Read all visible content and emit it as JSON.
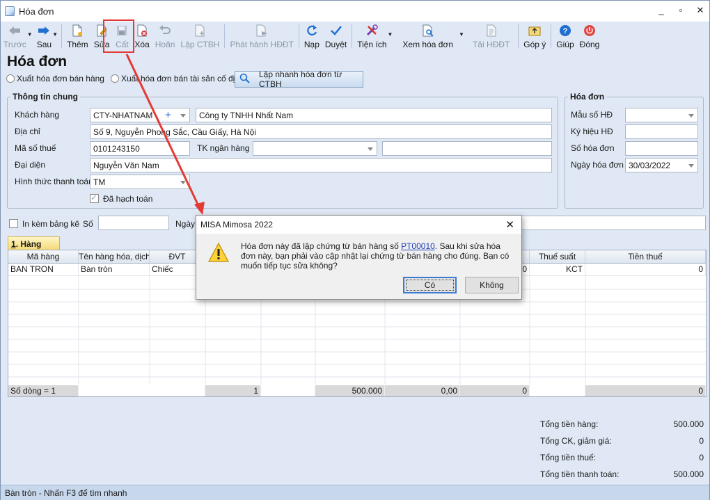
{
  "window": {
    "title": "Hóa đơn",
    "minimize": "_",
    "maximize": "▫",
    "close": "✕"
  },
  "toolbar": {
    "prev": "Trước",
    "next": "Sau",
    "add": "Thêm",
    "edit": "Sửa",
    "save": "Cất",
    "delete": "Xóa",
    "undo": "Hoãn",
    "create_ctbh": "Lập CTBH",
    "issue_hddt": "Phát hành HĐĐT",
    "reload": "Nạp",
    "approve": "Duyệt",
    "utilities": "Tiện ích",
    "view_invoice": "Xem hóa đơn",
    "download_hddt": "Tải HĐĐT",
    "feedback": "Góp ý",
    "help": "Giúp",
    "close": "Đóng"
  },
  "page": {
    "title": "Hóa đơn",
    "radio_sales": "Xuất hóa đơn bán hàng",
    "radio_assets": "Xuất hóa đơn bán tài sản cố định",
    "quick_create": "Lập nhanh hóa đơn từ CTBH"
  },
  "general": {
    "legend": "Thông tin chung",
    "customer_label": "Khách hàng",
    "customer_code": "CTY-NHATNAM",
    "customer_plus": "+",
    "customer_name": "Công ty TNHH Nhất Nam",
    "address_label": "Địa chỉ",
    "address": "Số 9, Nguyễn Phong Sắc, Cầu Giấy, Hà Nội",
    "taxcode_label": "Mã số thuế",
    "taxcode": "0101243150",
    "bank_label": "TK ngân hàng",
    "bank_account": "",
    "bank_name": "",
    "rep_label": "Đại diện",
    "rep": "Nguyễn Văn Nam",
    "payment_label": "Hình thức thanh toán",
    "payment": "TM",
    "posted_label": "Đã hạch toán"
  },
  "invoice": {
    "legend": "Hóa đơn",
    "template_label": "Mẫu số HĐ",
    "template": "",
    "symbol_label": "Ký hiệu HĐ",
    "symbol": "",
    "number_label": "Số hóa đơn",
    "number": "",
    "date_label": "Ngày hóa đơn",
    "date": "30/03/2022"
  },
  "attach": {
    "label": "In kèm bảng kê",
    "no_label": "Số",
    "no_value": "",
    "date_label": "Ngày"
  },
  "tab": {
    "num": "1",
    "label": ". Hàng tiền"
  },
  "grid": {
    "headers": {
      "code": "Mã hàng",
      "name": "Tên hàng hóa, dịch",
      "unit": "ĐVT",
      "tax_rate": "Thuế suất",
      "tax_amount": "Tiền thuế"
    },
    "row": {
      "code": "BAN TRON",
      "name": "Bàn tròn",
      "unit": "Chiếc",
      "discount": "0",
      "tax_rate": "KCT",
      "tax_amount": "0"
    },
    "summary": {
      "count": "Số dòng = 1",
      "qty": "1",
      "amount": "500.000",
      "disc_pct": "0,00",
      "disc": "0",
      "tax": "0"
    }
  },
  "totals": {
    "goods_label": "Tổng tiền hàng:",
    "goods": "500.000",
    "discount_label": "Tổng CK, giảm giá:",
    "discount": "0",
    "tax_label": "Tổng tiền thuế:",
    "tax": "0",
    "total_label": "Tổng tiền thanh toán:",
    "total": "500.000"
  },
  "status": {
    "text": "Bàn tròn - Nhấn F3 để tìm nhanh"
  },
  "dialog": {
    "title": "MISA Mimosa 2022",
    "msg_before": "Hóa đơn này đã lập chứng từ bán hàng số ",
    "msg_link": "PT00010",
    "msg_after": ". Sau khi sửa hóa đơn này, bạn phải vào cập nhật lại chứng từ bán hàng cho đúng. Bạn có muốn tiếp tục sửa không?",
    "yes": "Có",
    "no": "Không"
  },
  "colors": {
    "highlight": "#e53935",
    "toolbar_bg": "#dfe8f4",
    "tab_bg": "#f5d874"
  }
}
